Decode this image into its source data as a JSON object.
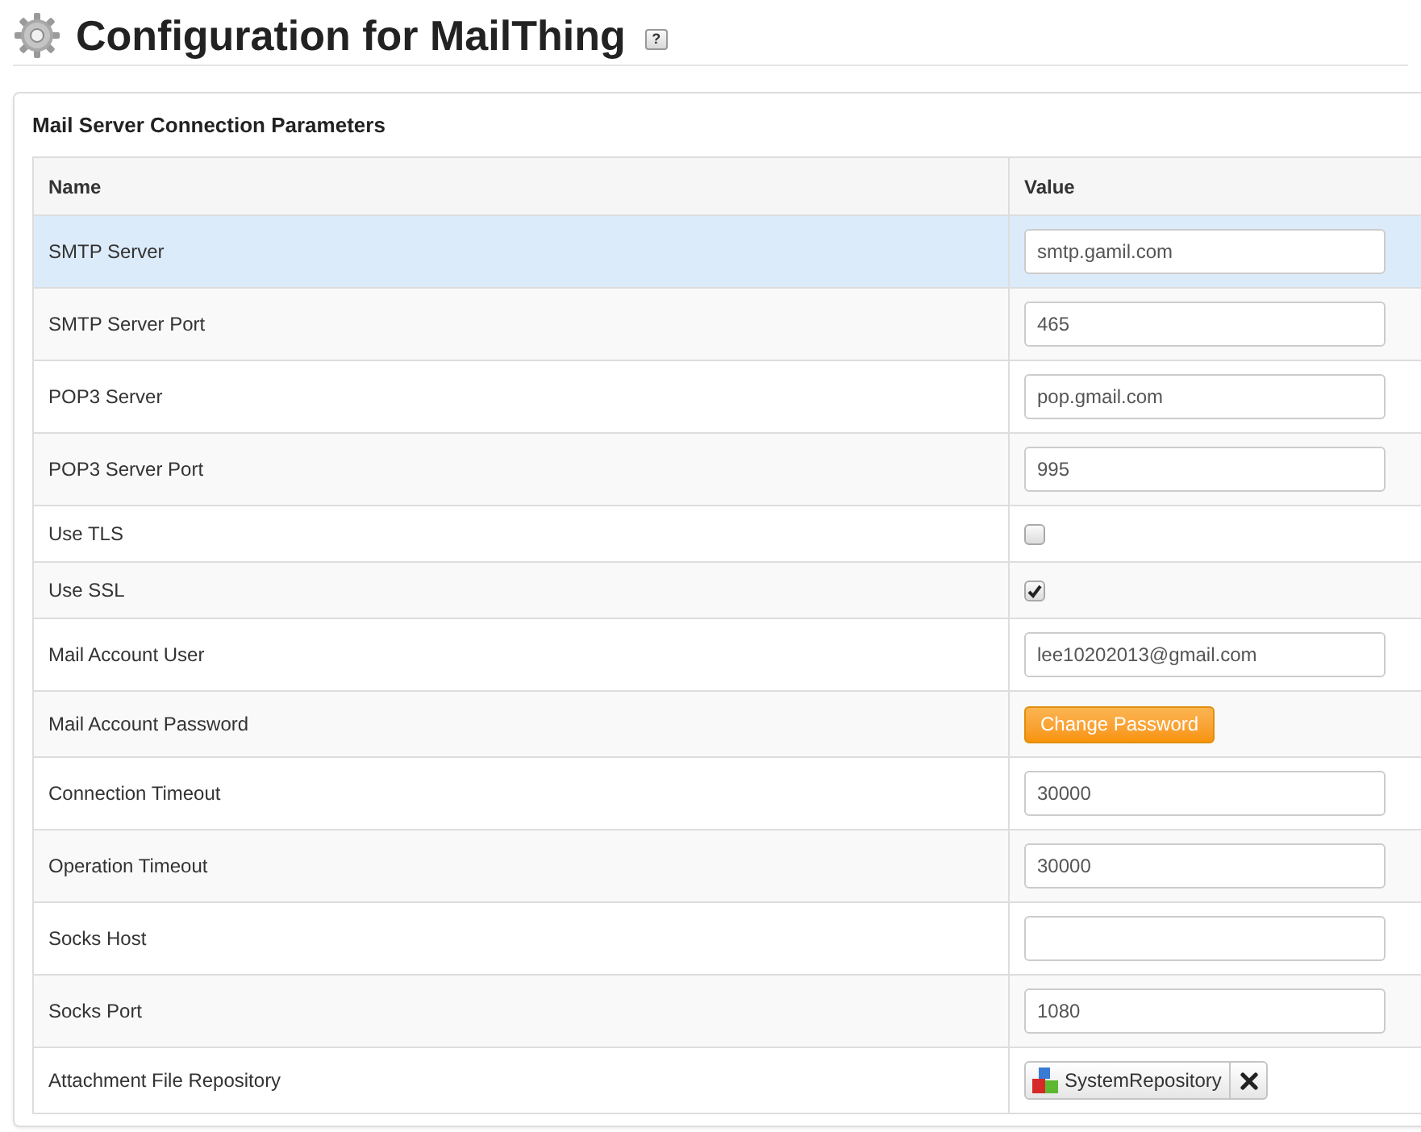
{
  "page": {
    "title": "Configuration for MailThing",
    "help_label": "?"
  },
  "panel": {
    "title": "Mail Server Connection Parameters",
    "table": {
      "columns": [
        "Name",
        "Value"
      ],
      "rows": [
        {
          "name": "SMTP Server",
          "kind": "text",
          "value": "smtp.gamil.com",
          "highlighted": true
        },
        {
          "name": "SMTP Server Port",
          "kind": "text",
          "value": "465",
          "highlighted": false
        },
        {
          "name": "POP3 Server",
          "kind": "text",
          "value": "pop.gmail.com",
          "highlighted": false
        },
        {
          "name": "POP3 Server Port",
          "kind": "text",
          "value": "995",
          "highlighted": false
        },
        {
          "name": "Use TLS",
          "kind": "checkbox",
          "checked": false,
          "highlighted": false
        },
        {
          "name": "Use SSL",
          "kind": "checkbox",
          "checked": true,
          "highlighted": false
        },
        {
          "name": "Mail Account User",
          "kind": "text",
          "value": "lee10202013@gmail.com",
          "highlighted": false
        },
        {
          "name": "Mail Account Password",
          "kind": "button",
          "label": "Change Password",
          "highlighted": false
        },
        {
          "name": "Connection Timeout",
          "kind": "text",
          "value": "30000",
          "highlighted": false
        },
        {
          "name": "Operation Timeout",
          "kind": "text",
          "value": "30000",
          "highlighted": false
        },
        {
          "name": "Socks Host",
          "kind": "text",
          "highlighted": false
        },
        {
          "name": "Socks Port",
          "kind": "text",
          "value": "1080",
          "highlighted": false
        },
        {
          "name": "Attachment File Repository",
          "kind": "picker",
          "value": "SystemRepository",
          "highlighted": false
        }
      ]
    }
  }
}
